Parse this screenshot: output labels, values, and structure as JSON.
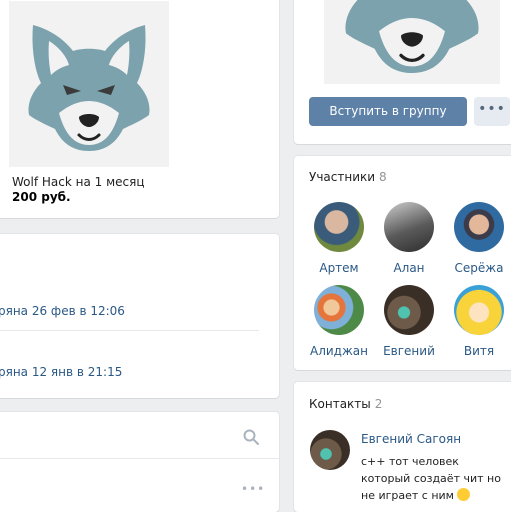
{
  "product": {
    "title": "Wolf Hack на 1 месяц",
    "price": "200 руб.",
    "image_icon": "wolf-logo"
  },
  "news": {
    "items": [
      "ряна 26 фев в 12:06",
      "ряна 12 янв в 21:15"
    ]
  },
  "group": {
    "join_label": "Вступить в группу",
    "more_label": "•••"
  },
  "members": {
    "title": "Участники",
    "count": "8",
    "people": [
      {
        "name": "Артем"
      },
      {
        "name": "Алан"
      },
      {
        "name": "Серёжа"
      },
      {
        "name": "Алиджан"
      },
      {
        "name": "Евгений"
      },
      {
        "name": "Витя"
      }
    ]
  },
  "contacts": {
    "title": "Контакты",
    "count": "2",
    "person": {
      "name": "Евгений Сагоян",
      "description": "с++ тот человек который создаёт чит но не играет с ним"
    }
  },
  "icons": {
    "search": "search-icon",
    "more": "more-dots-icon"
  },
  "colors": {
    "page_bg": "#edeef0",
    "link": "#2a5885",
    "button_primary": "#5e81a8",
    "button_secondary": "#e5ebf1",
    "wolf": "#7ba2ad"
  }
}
